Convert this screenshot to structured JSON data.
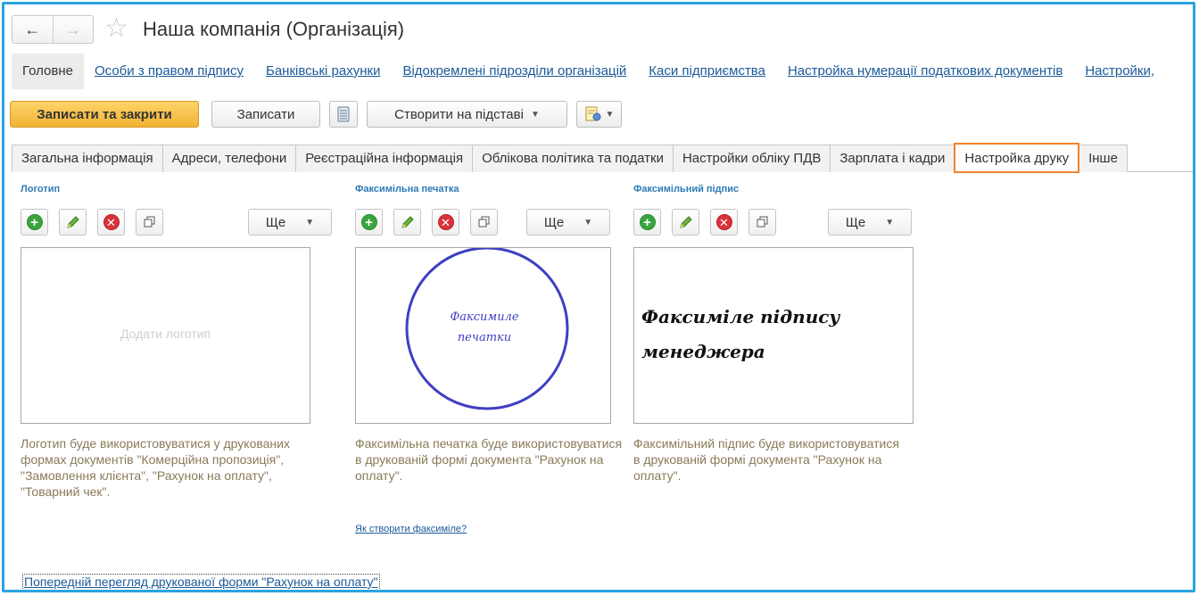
{
  "window": {
    "title": "Наша компанія (Організація)"
  },
  "nav": {
    "back": "←",
    "forward": "→"
  },
  "sections": {
    "main": "Головне",
    "links": [
      "Особи з правом підпису",
      "Банківські рахунки",
      "Відокремлені підрозділи організацій",
      "Каси підприємства",
      "Настройка нумерації податкових документів",
      "Настройки,"
    ]
  },
  "toolbar": {
    "save_close": "Записати та закрити",
    "save": "Записати",
    "create_based": "Створити на підставі"
  },
  "tabs": [
    "Загальна інформація",
    "Адреси, телефони",
    "Реєстраційна інформація",
    "Облікова політика та податки",
    "Настройки обліку ПДВ",
    "Зарплата і кадри",
    "Настройка друку",
    "Інше"
  ],
  "active_tab": "Настройка друку",
  "columns": {
    "logo": {
      "title": "Логотип",
      "more": "Ще",
      "placeholder": "Додати логотип",
      "description": "Логотип буде використовуватися у друкованих формах документів \"Комерційна пропозиція\", \"Замовлення клієнта\", \"Рахунок на оплату\", \"Товарний чек\"."
    },
    "stamp": {
      "title": "Факсимільна печатка",
      "more": "Ще",
      "image_text_1": "Факсимиле",
      "image_text_2": "печатки",
      "description": "Факсимільна печатка буде використовуватися в друкованій формі документа \"Рахунок на оплату\"."
    },
    "signature": {
      "title": "Факсимільний підпис",
      "more": "Ще",
      "image_text_1": "Факсиміле підпису",
      "image_text_2": "менеджера",
      "description": "Факсимільний підпис буде використовуватися в друкованій формі документа \"Рахунок на оплату\"."
    }
  },
  "how_to_link": "Як створити факсиміле?",
  "preview_link": "Попередній перегляд друкованої форми \"Рахунок на оплату\"",
  "colors": {
    "frame": "#29a3e0",
    "accent": "#f0822e",
    "primary_button": "#f2b233",
    "link": "#1c5a99",
    "section_title": "#2d7bb7",
    "description": "#8a7a58",
    "stamp": "#3f3fc4"
  }
}
